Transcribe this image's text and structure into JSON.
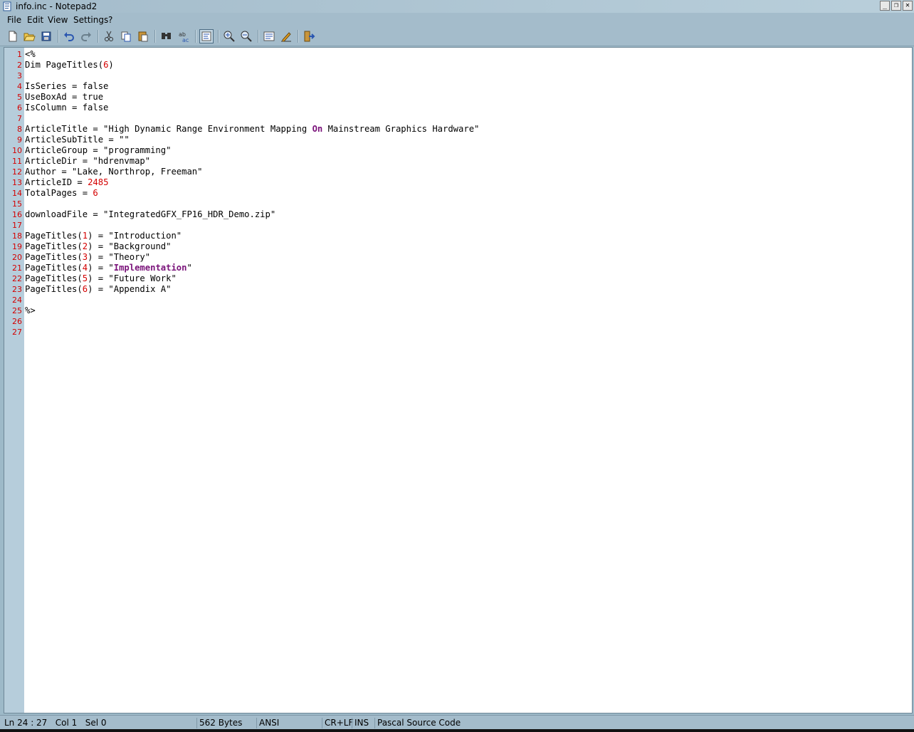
{
  "window": {
    "title": "info.inc - Notepad2"
  },
  "window_buttons": {
    "minimize": "_",
    "restore": "❐",
    "close": "✕"
  },
  "menu": [
    {
      "label": "File"
    },
    {
      "label": "Edit"
    },
    {
      "label": "View"
    },
    {
      "label": "Settings"
    },
    {
      "label": "?"
    }
  ],
  "toolbar_buttons": [
    "new-file-icon",
    "open-folder-icon",
    "save-icon",
    "undo-icon",
    "redo-icon",
    "cut-icon",
    "copy-icon",
    "paste-icon",
    "find-icon",
    "replace-icon",
    "word-wrap-icon",
    "zoom-in-icon",
    "zoom-out-icon",
    "scheme-icon",
    "customize-icon",
    "exit-icon"
  ],
  "editor": {
    "lines": [
      {
        "n": "1",
        "segs": [
          {
            "t": "<%"
          }
        ]
      },
      {
        "n": "2",
        "segs": [
          {
            "t": "Dim PageTitles("
          },
          {
            "t": "6",
            "c": "num"
          },
          {
            "t": ")"
          }
        ]
      },
      {
        "n": "3",
        "segs": []
      },
      {
        "n": "4",
        "segs": [
          {
            "t": "IsSeries = false"
          }
        ]
      },
      {
        "n": "5",
        "segs": [
          {
            "t": "UseBoxAd = true"
          }
        ]
      },
      {
        "n": "6",
        "segs": [
          {
            "t": "IsColumn = false"
          }
        ]
      },
      {
        "n": "7",
        "segs": []
      },
      {
        "n": "8",
        "segs": [
          {
            "t": "ArticleTitle = \"High Dynamic Range Environment Mapping "
          },
          {
            "t": "On",
            "c": "kw"
          },
          {
            "t": " Mainstream Graphics Hardware\""
          }
        ]
      },
      {
        "n": "9",
        "segs": [
          {
            "t": "ArticleSubTitle = \"\""
          }
        ]
      },
      {
        "n": "10",
        "segs": [
          {
            "t": "ArticleGroup = \"programming\""
          }
        ]
      },
      {
        "n": "11",
        "segs": [
          {
            "t": "ArticleDir = \"hdrenvmap\""
          }
        ]
      },
      {
        "n": "12",
        "segs": [
          {
            "t": "Author = \"Lake, Northrop, Freeman\""
          }
        ]
      },
      {
        "n": "13",
        "segs": [
          {
            "t": "ArticleID = "
          },
          {
            "t": "2485",
            "c": "num"
          }
        ]
      },
      {
        "n": "14",
        "segs": [
          {
            "t": "TotalPages = "
          },
          {
            "t": "6",
            "c": "num"
          }
        ]
      },
      {
        "n": "15",
        "segs": []
      },
      {
        "n": "16",
        "segs": [
          {
            "t": "downloadFile = \"IntegratedGFX_FP16_HDR_Demo.zip\""
          }
        ]
      },
      {
        "n": "17",
        "segs": []
      },
      {
        "n": "18",
        "segs": [
          {
            "t": "PageTitles("
          },
          {
            "t": "1",
            "c": "num"
          },
          {
            "t": ") = \"Introduction\""
          }
        ]
      },
      {
        "n": "19",
        "segs": [
          {
            "t": "PageTitles("
          },
          {
            "t": "2",
            "c": "num"
          },
          {
            "t": ") = \"Background\""
          }
        ]
      },
      {
        "n": "20",
        "segs": [
          {
            "t": "PageTitles("
          },
          {
            "t": "3",
            "c": "num"
          },
          {
            "t": ") = \"Theory\""
          }
        ]
      },
      {
        "n": "21",
        "segs": [
          {
            "t": "PageTitles("
          },
          {
            "t": "4",
            "c": "num"
          },
          {
            "t": ") = \""
          },
          {
            "t": "Implementation",
            "c": "kw"
          },
          {
            "t": "\""
          }
        ]
      },
      {
        "n": "22",
        "segs": [
          {
            "t": "PageTitles("
          },
          {
            "t": "5",
            "c": "num"
          },
          {
            "t": ") = \"Future Work\""
          }
        ]
      },
      {
        "n": "23",
        "segs": [
          {
            "t": "PageTitles("
          },
          {
            "t": "6",
            "c": "num"
          },
          {
            "t": ") = \"Appendix A\""
          }
        ]
      },
      {
        "n": "24",
        "segs": []
      },
      {
        "n": "25",
        "segs": [
          {
            "t": "%>"
          }
        ]
      },
      {
        "n": "26",
        "segs": []
      },
      {
        "n": "27",
        "segs": []
      }
    ]
  },
  "status": {
    "position": "Ln 24 : 27   Col 1   Sel 0",
    "size": "562 Bytes",
    "encoding": "ANSI",
    "line_endings": "CR+LF",
    "mode": "INS",
    "lexer": "Pascal Source Code"
  },
  "colors": {
    "line_number": "#d40000",
    "number_literal": "#d40000",
    "keyword": "#7a127a",
    "chrome": "#a4bccb"
  }
}
